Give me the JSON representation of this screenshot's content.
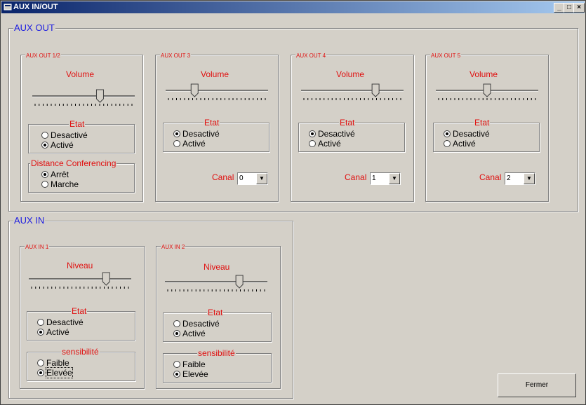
{
  "window": {
    "title": "AUX IN/OUT"
  },
  "aux_out": {
    "title": "AUX OUT",
    "channels": [
      {
        "title": "AUX OUT 1/2",
        "volume_label": "Volume",
        "volume": 0.67,
        "etat_title": "Etat",
        "etat_options": [
          "Desactivé",
          "Activé"
        ],
        "etat_selected": 1,
        "dc_title": "Distance Conferencing",
        "dc_options": [
          "Arrêt",
          "Marche"
        ],
        "dc_selected": 0
      },
      {
        "title": "AUX OUT 3",
        "volume_label": "Volume",
        "volume": 0.27,
        "etat_title": "Etat",
        "etat_options": [
          "Desactivé",
          "Activé"
        ],
        "etat_selected": 0,
        "canal_label": "Canal",
        "canal_value": "0"
      },
      {
        "title": "AUX OUT 4",
        "volume_label": "Volume",
        "volume": 0.74,
        "etat_title": "Etat",
        "etat_options": [
          "Desactivé",
          "Activé"
        ],
        "etat_selected": 0,
        "canal_label": "Canal",
        "canal_value": "1"
      },
      {
        "title": "AUX OUT 5",
        "volume_label": "Volume",
        "volume": 0.5,
        "etat_title": "Etat",
        "etat_options": [
          "Desactivé",
          "Activé"
        ],
        "etat_selected": 0,
        "canal_label": "Canal",
        "canal_value": "2"
      }
    ]
  },
  "aux_in": {
    "title": "AUX IN",
    "channels": [
      {
        "title": "AUX IN 1",
        "niveau_label": "Niveau",
        "niveau": 0.77,
        "etat_title": "Etat",
        "etat_options": [
          "Desactivé",
          "Activé"
        ],
        "etat_selected": 1,
        "sens_title": "sensibilité",
        "sens_options": [
          "Faible",
          "Elevée"
        ],
        "sens_selected": 1
      },
      {
        "title": "AUX IN 2",
        "niveau_label": "Niveau",
        "niveau": 0.74,
        "etat_title": "Etat",
        "etat_options": [
          "Desactivé",
          "Activé"
        ],
        "etat_selected": 1,
        "sens_title": "sensibilité",
        "sens_options": [
          "Faible",
          "Elevée"
        ],
        "sens_selected": 1
      }
    ]
  },
  "buttons": {
    "close": "Fermer"
  },
  "colors": {
    "group_title": "#2020e0",
    "label": "#e01010",
    "titlebar_start": "#0a246a",
    "titlebar_end": "#a6caf0"
  },
  "icons": {
    "window": "window-app-icon",
    "minimize": "minimize-icon",
    "maximize": "maximize-icon",
    "close": "close-icon"
  }
}
